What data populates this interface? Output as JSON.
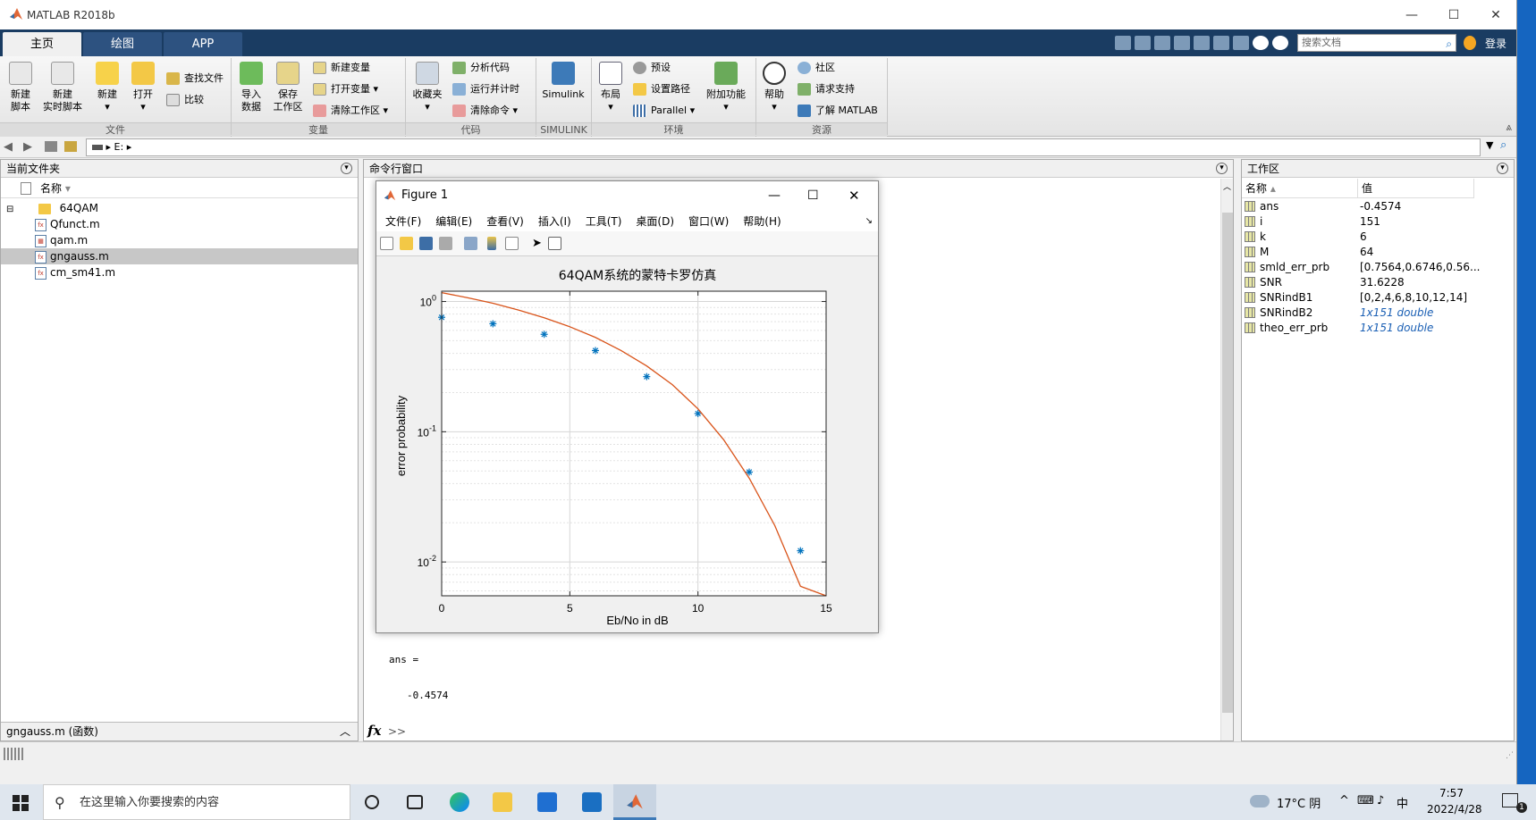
{
  "window": {
    "title": "MATLAB R2018b"
  },
  "tabs": [
    "主页",
    "绘图",
    "APP"
  ],
  "search": {
    "placeholder": "搜索文档"
  },
  "login": "登录",
  "ribbon": {
    "file": {
      "new_script": [
        "新建",
        "脚本"
      ],
      "new_live": [
        "新建",
        "实时脚本"
      ],
      "new": "新建",
      "open": "打开",
      "find_files": "查找文件",
      "compare": "比较",
      "label": "文件"
    },
    "variable": {
      "import": [
        "导入",
        "数据"
      ],
      "save": [
        "保存",
        "工作区"
      ],
      "new_var": "新建变量",
      "open_var": "打开变量",
      "clear_ws": "清除工作区",
      "label": "变量"
    },
    "code": {
      "favorites": "收藏夹",
      "analyze": "分析代码",
      "run_time": "运行并计时",
      "clear_cmd": "清除命令",
      "label": "代码"
    },
    "simulink": {
      "btn": "Simulink",
      "label": "SIMULINK"
    },
    "env": {
      "layout": "布局",
      "prefs": "预设",
      "set_path": "设置路径",
      "parallel": "Parallel",
      "addons": "附加功能",
      "label": "环境"
    },
    "resources": {
      "help": "帮助",
      "community": "社区",
      "support": "请求支持",
      "learn": "了解 MATLAB",
      "label": "资源"
    }
  },
  "address": {
    "path": "E:",
    "sep": "▸"
  },
  "current_folder": {
    "title": "当前文件夹",
    "col_name": "名称",
    "folder": "64QAM",
    "files": [
      "Qfunct.m",
      "qam.m",
      "gngauss.m",
      "cm_sm41.m"
    ],
    "selected": "gngauss.m",
    "detail": "gngauss.m  (函数)"
  },
  "command_window": {
    "title": "命令行窗口",
    "lines": [
      "ans =",
      "-0.4574"
    ],
    "prompt": ">>",
    "fx": "fx"
  },
  "workspace": {
    "title": "工作区",
    "col_name": "名称",
    "col_value": "值",
    "vars": [
      {
        "name": "ans",
        "value": "-0.4574"
      },
      {
        "name": "i",
        "value": "151"
      },
      {
        "name": "k",
        "value": "6"
      },
      {
        "name": "M",
        "value": "64"
      },
      {
        "name": "smld_err_prb",
        "value": "[0.7564,0.6746,0.56..."
      },
      {
        "name": "SNR",
        "value": "31.6228"
      },
      {
        "name": "SNRindB1",
        "value": "[0,2,4,6,8,10,12,14]"
      },
      {
        "name": "SNRindB2",
        "value": "1x151 double"
      },
      {
        "name": "theo_err_prb",
        "value": "1x151 double"
      }
    ]
  },
  "figure": {
    "title": "Figure 1",
    "menu": [
      "文件(F)",
      "编辑(E)",
      "查看(V)",
      "插入(I)",
      "工具(T)",
      "桌面(D)",
      "窗口(W)",
      "帮助(H)"
    ]
  },
  "chart_data": {
    "type": "line",
    "title": "64QAM系统的蒙特卡罗仿真",
    "xlabel": "Eb/No in dB",
    "ylabel": "error probability",
    "xlim": [
      0,
      15
    ],
    "ylim": [
      0.0055,
      1.2
    ],
    "yscale": "log",
    "grid": true,
    "xticks": [
      0,
      5,
      10,
      15
    ],
    "yticks": [
      {
        "value": 1,
        "base": "10",
        "exp": "0"
      },
      {
        "value": 0.1,
        "base": "10",
        "exp": "-1"
      },
      {
        "value": 0.01,
        "base": "10",
        "exp": "-2"
      }
    ],
    "series": [
      {
        "style": "markers-asterisk",
        "color": "#0072bd",
        "x": [
          0,
          2,
          4,
          6,
          8,
          10,
          12,
          14
        ],
        "y": [
          0.7564,
          0.6746,
          0.56,
          0.42,
          0.265,
          0.138,
          0.049,
          0.0122
        ]
      },
      {
        "style": "line",
        "color": "#d95319",
        "x": [
          0,
          1,
          2,
          3,
          4,
          5,
          6,
          7,
          8,
          9,
          10,
          11,
          12,
          13,
          14,
          15
        ],
        "y": [
          1.17,
          1.07,
          0.97,
          0.86,
          0.75,
          0.64,
          0.53,
          0.42,
          0.32,
          0.23,
          0.15,
          0.087,
          0.044,
          0.019,
          0.0065,
          0.0055
        ]
      }
    ]
  },
  "taskbar": {
    "search_placeholder": "在这里输入你要搜索的内容",
    "weather": "17°C 阴",
    "ime": "中",
    "time": "7:57",
    "date": "2022/4/28",
    "notif": "1"
  }
}
